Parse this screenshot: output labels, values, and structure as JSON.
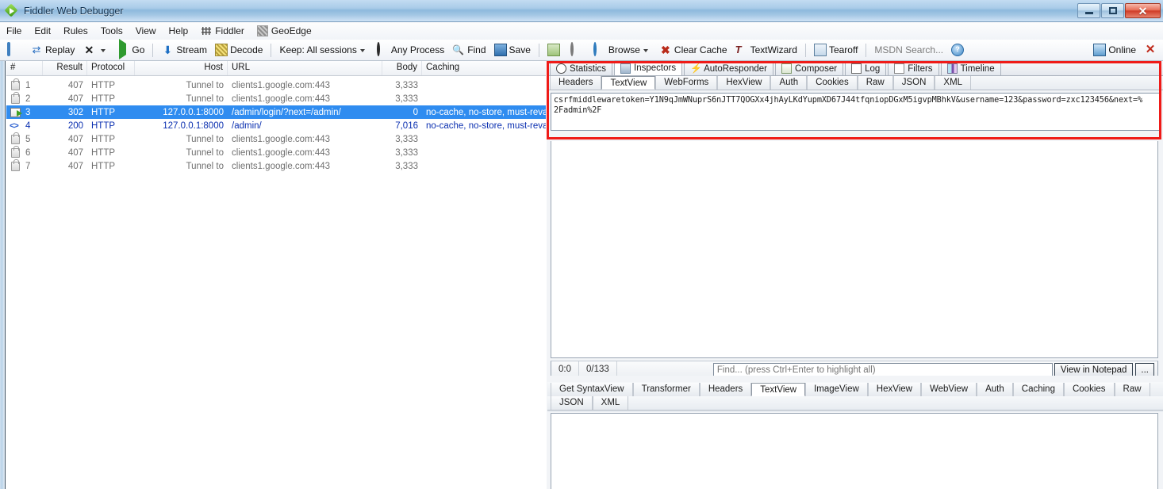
{
  "window": {
    "title": "Fiddler Web Debugger",
    "app_icon": "fiddler-logo-icon",
    "minimize": "minimize-icon",
    "maximize": "maximize-icon",
    "close": "close-icon"
  },
  "menubar": {
    "items": [
      {
        "label": "File",
        "icon": null
      },
      {
        "label": "Edit",
        "icon": null
      },
      {
        "label": "Rules",
        "icon": null
      },
      {
        "label": "Tools",
        "icon": null
      },
      {
        "label": "View",
        "icon": null
      },
      {
        "label": "Help",
        "icon": null
      },
      {
        "label": "Fiddler",
        "icon": "fiddler-grid-icon"
      },
      {
        "label": "GeoEdge",
        "icon": "geoedge-icon"
      }
    ]
  },
  "toolbar": {
    "comment_label": "",
    "replay_label": "Replay",
    "remove_label": "",
    "go_label": "Go",
    "stream_label": "Stream",
    "decode_label": "Decode",
    "keep_label": "Keep: All sessions",
    "any_process_label": "Any Process",
    "find_label": "Find",
    "save_label": "Save",
    "browse_label": "Browse",
    "clear_cache_label": "Clear Cache",
    "textwizard_label": "TextWizard",
    "tearoff_label": "Tearoff",
    "msdn_label": "MSDN Search...",
    "online_label": "Online",
    "close_label": "✕",
    "help_glyph": "?"
  },
  "sessions": {
    "columns": [
      {
        "key": "num",
        "label": "#",
        "align": "left"
      },
      {
        "key": "result",
        "label": "Result",
        "align": "right"
      },
      {
        "key": "protocol",
        "label": "Protocol",
        "align": "left"
      },
      {
        "key": "host",
        "label": "Host",
        "align": "right"
      },
      {
        "key": "url",
        "label": "URL",
        "align": "left"
      },
      {
        "key": "body",
        "label": "Body",
        "align": "right"
      },
      {
        "key": "caching",
        "label": "Caching",
        "align": "left"
      }
    ],
    "rows": [
      {
        "icon": "lock-icon",
        "num": "1",
        "result": "407",
        "protocol": "HTTP",
        "host": "Tunnel to",
        "url": "clients1.google.com:443",
        "body": "3,333",
        "caching": "",
        "state": "normal"
      },
      {
        "icon": "lock-icon",
        "num": "2",
        "result": "407",
        "protocol": "HTTP",
        "host": "Tunnel to",
        "url": "clients1.google.com:443",
        "body": "3,333",
        "caching": "",
        "state": "normal"
      },
      {
        "icon": "redirect-icon",
        "num": "3",
        "result": "302",
        "protocol": "HTTP",
        "host": "127.0.0.1:8000",
        "url": "/admin/login/?next=/admin/",
        "body": "0",
        "caching": "no-cache, no-store, must-revalidate, ma.",
        "state": "selected"
      },
      {
        "icon": "html-icon",
        "num": "4",
        "result": "200",
        "protocol": "HTTP",
        "host": "127.0.0.1:8000",
        "url": "/admin/",
        "body": "7,016",
        "caching": "no-cache, no-store, must-revalidate, ma.",
        "state": "highlight"
      },
      {
        "icon": "lock-icon",
        "num": "5",
        "result": "407",
        "protocol": "HTTP",
        "host": "Tunnel to",
        "url": "clients1.google.com:443",
        "body": "3,333",
        "caching": "",
        "state": "normal"
      },
      {
        "icon": "lock-icon",
        "num": "6",
        "result": "407",
        "protocol": "HTTP",
        "host": "Tunnel to",
        "url": "clients1.google.com:443",
        "body": "3,333",
        "caching": "",
        "state": "normal"
      },
      {
        "icon": "lock-icon",
        "num": "7",
        "result": "407",
        "protocol": "HTTP",
        "host": "Tunnel to",
        "url": "clients1.google.com:443",
        "body": "3,333",
        "caching": "",
        "state": "normal"
      }
    ]
  },
  "inspector": {
    "main_tabs": [
      {
        "label": "Statistics",
        "icon": "statistics-icon",
        "active": false
      },
      {
        "label": "Inspectors",
        "icon": "inspectors-icon",
        "active": true
      },
      {
        "label": "AutoResponder",
        "icon": "autoresponder-icon",
        "active": false
      },
      {
        "label": "Composer",
        "icon": "composer-icon",
        "active": false
      },
      {
        "label": "Log",
        "icon": "log-icon",
        "active": false
      },
      {
        "label": "Filters",
        "icon": "filters-icon",
        "active": false
      },
      {
        "label": "Timeline",
        "icon": "timeline-icon",
        "active": false
      }
    ],
    "request_tabs": [
      {
        "label": "Headers",
        "active": false
      },
      {
        "label": "TextView",
        "active": true
      },
      {
        "label": "WebForms",
        "active": false
      },
      {
        "label": "HexView",
        "active": false
      },
      {
        "label": "Auth",
        "active": false
      },
      {
        "label": "Cookies",
        "active": false
      },
      {
        "label": "Raw",
        "active": false
      },
      {
        "label": "JSON",
        "active": false
      },
      {
        "label": "XML",
        "active": false
      }
    ],
    "request_body": {
      "line1": "csrfmiddlewaretoken=Y1N9qJmWNuprS6nJTT7QOGXx4jhAyLKdYupmXD67J44tfqniopDGxM5igvpMBhkV&username=123&password=zxc123456&next=%",
      "line2": "2Fadmin%2F"
    },
    "statusbar": {
      "position": "0:0",
      "counter": "0/133",
      "find_placeholder": "Find... (press Ctrl+Enter to highlight all)",
      "find_value": "",
      "view_notepad_label": "View in Notepad",
      "more_label": "..."
    },
    "response_tabs": [
      {
        "label": "Get SyntaxView",
        "active": false
      },
      {
        "label": "Transformer",
        "active": false
      },
      {
        "label": "Headers",
        "active": false
      },
      {
        "label": "TextView",
        "active": true
      },
      {
        "label": "ImageView",
        "active": false
      },
      {
        "label": "HexView",
        "active": false
      },
      {
        "label": "WebView",
        "active": false
      },
      {
        "label": "Auth",
        "active": false
      },
      {
        "label": "Caching",
        "active": false
      },
      {
        "label": "Cookies",
        "active": false
      },
      {
        "label": "Raw",
        "active": false
      },
      {
        "label": "JSON",
        "active": false
      },
      {
        "label": "XML",
        "active": false
      }
    ]
  },
  "colors": {
    "highlight": "#2f8cf0",
    "annotation_red": "#ef1b18",
    "link_blue": "#0a2fb0",
    "close_red": "#c02b1c"
  }
}
